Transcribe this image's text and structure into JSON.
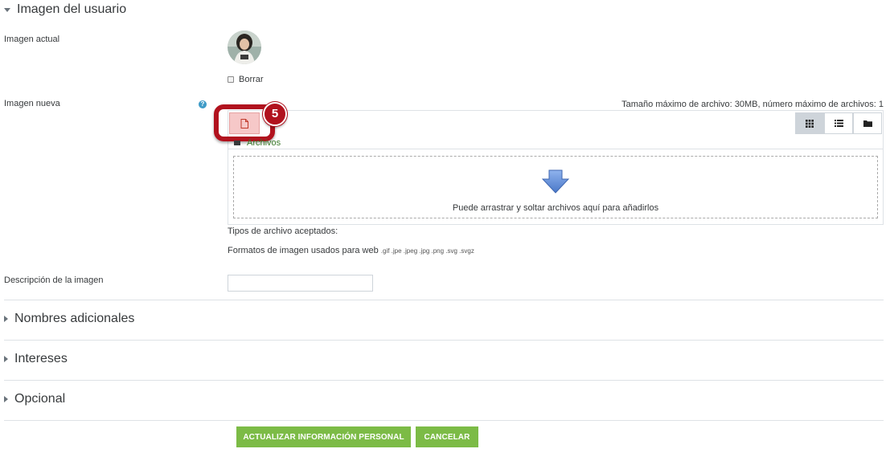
{
  "sections": {
    "user_image": "Imagen del usuario",
    "additional_names": "Nombres adicionales",
    "interests": "Intereses",
    "optional": "Opcional"
  },
  "fields": {
    "current_image_label": "Imagen actual",
    "delete_label": "Borrar",
    "new_image_label": "Imagen nueva",
    "description_label": "Descripción de la imagen",
    "description_value": ""
  },
  "filepicker": {
    "max_size_text": "Tamaño máximo de archivo: 30MB, número máximo de archivos: 1",
    "files_label": "Archivos",
    "drop_text": "Puede arrastrar y soltar archivos aquí para añadirlos",
    "accepted_types_label": "Tipos de archivo aceptados:",
    "formats_label": "Formatos de imagen usados para web",
    "formats_extensions": ".gif .jpe .jpeg .jpg .png .svg .svgz",
    "step_badge": "5",
    "view_modes": [
      "grid-icon",
      "list-icon",
      "folder-icon"
    ],
    "active_view": "grid-icon"
  },
  "buttons": {
    "update": "ACTUALIZAR INFORMACIÓN PERSONAL",
    "cancel": "CANCELAR"
  },
  "colors": {
    "accent_green": "#7cbb46",
    "highlight_red": "#b1121e",
    "help_blue": "#3f9bc7"
  }
}
